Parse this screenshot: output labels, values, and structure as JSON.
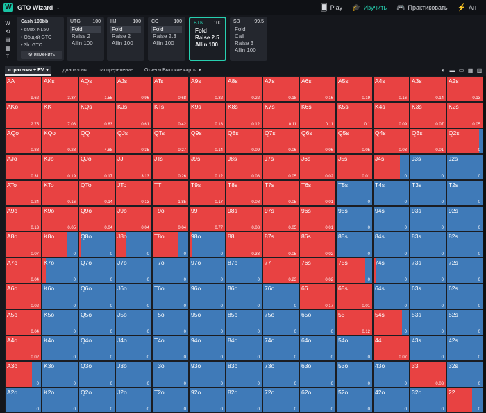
{
  "header": {
    "logo_letter": "W",
    "brand": "GTO Wizard",
    "nav": [
      {
        "icon": "cards-icon",
        "glyph": "🂠",
        "label": "Play",
        "active": false
      },
      {
        "icon": "graduation-cap-icon",
        "glyph": "🎓",
        "label": "Изучить",
        "active": true
      },
      {
        "icon": "gamepad-icon",
        "glyph": "🎮",
        "label": "Практиковать",
        "active": false
      },
      {
        "icon": "analyze-icon",
        "glyph": "⚡",
        "label": "Ан",
        "active": false
      }
    ]
  },
  "rail_icons": [
    "W",
    "⟲",
    "▤",
    "▦",
    "⌶"
  ],
  "info": {
    "title": "Cash 100bb",
    "lines": [
      "6Max NL50",
      "Общий GTO",
      "3b: GTO"
    ],
    "edit_label": "⚙ изменить"
  },
  "positions": [
    {
      "name": "UTG",
      "stack": "100",
      "options": [
        "Fold",
        "Raise 2",
        "Allin 100"
      ],
      "selected": 0,
      "active": false
    },
    {
      "name": "HJ",
      "stack": "100",
      "options": [
        "Fold",
        "Raise 2",
        "Allin 100"
      ],
      "selected": 0,
      "active": false
    },
    {
      "name": "CO",
      "stack": "100",
      "options": [
        "Fold",
        "Raise 2.3",
        "Allin 100"
      ],
      "selected": 0,
      "active": false
    },
    {
      "name": "BTN",
      "stack": "100",
      "options": [
        "Fold",
        "Raise 2.5",
        "Allin 100"
      ],
      "selected": -1,
      "active": true
    },
    {
      "name": "SB",
      "stack": "99.5",
      "options": [
        "Fold",
        "Call",
        "Raise 3",
        "Allin 100"
      ],
      "selected": -1,
      "active": false
    }
  ],
  "tabs": [
    {
      "label": "стратегия + EV",
      "caret": "▾"
    },
    {
      "label": "диапазоны",
      "caret": ""
    },
    {
      "label": "распределение",
      "caret": ""
    },
    {
      "label": "Отчеты:Высокие карты",
      "caret": "▾"
    }
  ],
  "tool_icons": [
    "◐",
    "▬",
    "▭",
    "▦",
    "▥"
  ],
  "colors": {
    "raise": "#e84242",
    "fold": "#3f7ab8"
  },
  "matrix": [
    [
      [
        "AA",
        1,
        "9.62"
      ],
      [
        "AKs",
        1,
        "3.37"
      ],
      [
        "AQs",
        1,
        "1.55"
      ],
      [
        "AJs",
        1,
        "0.96"
      ],
      [
        "ATs",
        1,
        "0.68"
      ],
      [
        "A9s",
        1,
        "0.32"
      ],
      [
        "A8s",
        1,
        "0.22"
      ],
      [
        "A7s",
        1,
        "0.18"
      ],
      [
        "A6s",
        1,
        "0.16"
      ],
      [
        "A5s",
        1,
        "0.19"
      ],
      [
        "A4s",
        1,
        "0.16"
      ],
      [
        "A3s",
        1,
        "0.14"
      ],
      [
        "A2s",
        1,
        "0.13"
      ]
    ],
    [
      [
        "AKo",
        1,
        "2.75"
      ],
      [
        "KK",
        1,
        "7.08"
      ],
      [
        "KQs",
        1,
        "0.83"
      ],
      [
        "KJs",
        1,
        "0.61"
      ],
      [
        "KTs",
        1,
        "0.42"
      ],
      [
        "K9s",
        1,
        "0.18"
      ],
      [
        "K8s",
        1,
        "0.12"
      ],
      [
        "K7s",
        1,
        "0.11"
      ],
      [
        "K6s",
        1,
        "0.11"
      ],
      [
        "K5s",
        1,
        "0.1"
      ],
      [
        "K4s",
        1,
        "0.09"
      ],
      [
        "K3s",
        1,
        "0.07"
      ],
      [
        "K2s",
        1,
        "0.05"
      ]
    ],
    [
      [
        "AQo",
        1,
        "0.88"
      ],
      [
        "KQo",
        1,
        "0.28"
      ],
      [
        "QQ",
        1,
        "4.88"
      ],
      [
        "QJs",
        1,
        "0.35"
      ],
      [
        "QTs",
        1,
        "0.27"
      ],
      [
        "Q9s",
        1,
        "0.14"
      ],
      [
        "Q8s",
        1,
        "0.09"
      ],
      [
        "Q7s",
        1,
        "0.06"
      ],
      [
        "Q6s",
        1,
        "0.06"
      ],
      [
        "Q5s",
        1,
        "0.05"
      ],
      [
        "Q4s",
        1,
        "0.03"
      ],
      [
        "Q3s",
        1,
        "0.01"
      ],
      [
        "Q2s",
        0.9,
        "0"
      ]
    ],
    [
      [
        "AJo",
        1,
        "0.31"
      ],
      [
        "KJo",
        1,
        "0.19"
      ],
      [
        "QJo",
        1,
        "0.17"
      ],
      [
        "JJ",
        1,
        "3.13"
      ],
      [
        "JTs",
        1,
        "0.26"
      ],
      [
        "J9s",
        1,
        "0.12"
      ],
      [
        "J8s",
        1,
        "0.08"
      ],
      [
        "J7s",
        1,
        "0.05"
      ],
      [
        "J6s",
        1,
        "0.02"
      ],
      [
        "J5s",
        1,
        "0.01"
      ],
      [
        "J4s",
        0.75,
        "0"
      ],
      [
        "J3s",
        0,
        "0"
      ],
      [
        "J2s",
        0,
        "0"
      ]
    ],
    [
      [
        "ATo",
        1,
        "0.24"
      ],
      [
        "KTo",
        1,
        "0.16"
      ],
      [
        "QTo",
        1,
        "0.14"
      ],
      [
        "JTo",
        1,
        "0.13"
      ],
      [
        "TT",
        1,
        "1.85"
      ],
      [
        "T9s",
        1,
        "0.17"
      ],
      [
        "T8s",
        1,
        "0.08"
      ],
      [
        "T7s",
        1,
        "0.05"
      ],
      [
        "T6s",
        1,
        "0.01"
      ],
      [
        "T5s",
        0,
        "0"
      ],
      [
        "T4s",
        0,
        "0"
      ],
      [
        "T3s",
        0,
        "0"
      ],
      [
        "T2s",
        0,
        "0"
      ]
    ],
    [
      [
        "A9o",
        1,
        "0.13"
      ],
      [
        "K9o",
        1,
        "0.05"
      ],
      [
        "Q9o",
        1,
        "0.04"
      ],
      [
        "J9o",
        1,
        "0.04"
      ],
      [
        "T9o",
        1,
        "0.04"
      ],
      [
        "99",
        1,
        "0.77"
      ],
      [
        "98s",
        1,
        "0.08"
      ],
      [
        "97s",
        1,
        "0.05"
      ],
      [
        "96s",
        1,
        "0.01"
      ],
      [
        "95s",
        0,
        "0"
      ],
      [
        "94s",
        0,
        "0"
      ],
      [
        "93s",
        0,
        "0"
      ],
      [
        "92s",
        0,
        "0"
      ]
    ],
    [
      [
        "A8o",
        1,
        "0.07"
      ],
      [
        "K8o",
        0.7,
        "0"
      ],
      [
        "Q8o",
        0.05,
        "0"
      ],
      [
        "J8o",
        0.3,
        "0"
      ],
      [
        "T8o",
        0.7,
        "0"
      ],
      [
        "98o",
        0.05,
        "0"
      ],
      [
        "88",
        1,
        "0.33"
      ],
      [
        "87s",
        1,
        "0.05"
      ],
      [
        "86s",
        1,
        "0.02"
      ],
      [
        "85s",
        0,
        "0"
      ],
      [
        "84s",
        0,
        "0"
      ],
      [
        "83s",
        0,
        "0"
      ],
      [
        "82s",
        0,
        "0"
      ]
    ],
    [
      [
        "A7o",
        1,
        "0.04"
      ],
      [
        "K7o",
        0.1,
        "0"
      ],
      [
        "Q7o",
        0,
        "0"
      ],
      [
        "J7o",
        0,
        "0"
      ],
      [
        "T7o",
        0,
        "0"
      ],
      [
        "97o",
        0,
        "0"
      ],
      [
        "87o",
        0,
        "0"
      ],
      [
        "77",
        1,
        "0.23"
      ],
      [
        "76s",
        1,
        "0.02"
      ],
      [
        "75s",
        0.8,
        "0"
      ],
      [
        "74s",
        0.05,
        "0"
      ],
      [
        "73s",
        0,
        "0"
      ],
      [
        "72s",
        0,
        "0"
      ]
    ],
    [
      [
        "A6o",
        1,
        "0.02"
      ],
      [
        "K6o",
        0,
        "0"
      ],
      [
        "Q6o",
        0,
        "0"
      ],
      [
        "J6o",
        0,
        "0"
      ],
      [
        "T6o",
        0,
        "0"
      ],
      [
        "96o",
        0,
        "0"
      ],
      [
        "86o",
        0,
        "0"
      ],
      [
        "76o",
        0,
        "0"
      ],
      [
        "66",
        1,
        "0.17"
      ],
      [
        "65s",
        1,
        "0.01"
      ],
      [
        "64s",
        0,
        "0"
      ],
      [
        "63s",
        0,
        "0"
      ],
      [
        "62s",
        0,
        "0"
      ]
    ],
    [
      [
        "A5o",
        1,
        "0.04"
      ],
      [
        "K5o",
        0,
        "0"
      ],
      [
        "Q5o",
        0,
        "0"
      ],
      [
        "J5o",
        0,
        "0"
      ],
      [
        "T5o",
        0,
        "0"
      ],
      [
        "95o",
        0,
        "0"
      ],
      [
        "85o",
        0,
        "0"
      ],
      [
        "75o",
        0,
        "0"
      ],
      [
        "65o",
        0,
        "0"
      ],
      [
        "55",
        1,
        "0.12"
      ],
      [
        "54s",
        0.8,
        "0"
      ],
      [
        "53s",
        0,
        "0"
      ],
      [
        "52s",
        0,
        "0"
      ]
    ],
    [
      [
        "A4o",
        1,
        "0.02"
      ],
      [
        "K4o",
        0,
        "0"
      ],
      [
        "Q4o",
        0,
        "0"
      ],
      [
        "J4o",
        0,
        "0"
      ],
      [
        "T4o",
        0,
        "0"
      ],
      [
        "94o",
        0,
        "0"
      ],
      [
        "84o",
        0,
        "0"
      ],
      [
        "74o",
        0,
        "0"
      ],
      [
        "64o",
        0,
        "0"
      ],
      [
        "54o",
        0,
        "0"
      ],
      [
        "44",
        1,
        "0.07"
      ],
      [
        "43s",
        0,
        "0"
      ],
      [
        "42s",
        0,
        "0"
      ]
    ],
    [
      [
        "A3o",
        0.75,
        "0"
      ],
      [
        "K3o",
        0,
        "0"
      ],
      [
        "Q3o",
        0,
        "0"
      ],
      [
        "J3o",
        0,
        "0"
      ],
      [
        "T3o",
        0,
        "0"
      ],
      [
        "93o",
        0,
        "0"
      ],
      [
        "83o",
        0,
        "0"
      ],
      [
        "73o",
        0,
        "0"
      ],
      [
        "63o",
        0,
        "0"
      ],
      [
        "53o",
        0,
        "0"
      ],
      [
        "43o",
        0,
        "0"
      ],
      [
        "33",
        1,
        "0.03"
      ],
      [
        "32s",
        0,
        "0"
      ]
    ],
    [
      [
        "A2o",
        0,
        "0"
      ],
      [
        "K2o",
        0,
        "0"
      ],
      [
        "Q2o",
        0,
        "0"
      ],
      [
        "J2o",
        0,
        "0"
      ],
      [
        "T2o",
        0,
        "0"
      ],
      [
        "92o",
        0,
        "0"
      ],
      [
        "82o",
        0,
        "0"
      ],
      [
        "72o",
        0,
        "0"
      ],
      [
        "62o",
        0,
        "0"
      ],
      [
        "52o",
        0,
        "0"
      ],
      [
        "42o",
        0,
        "0"
      ],
      [
        "32o",
        0,
        "0"
      ],
      [
        "22",
        0.7,
        "0"
      ]
    ]
  ]
}
